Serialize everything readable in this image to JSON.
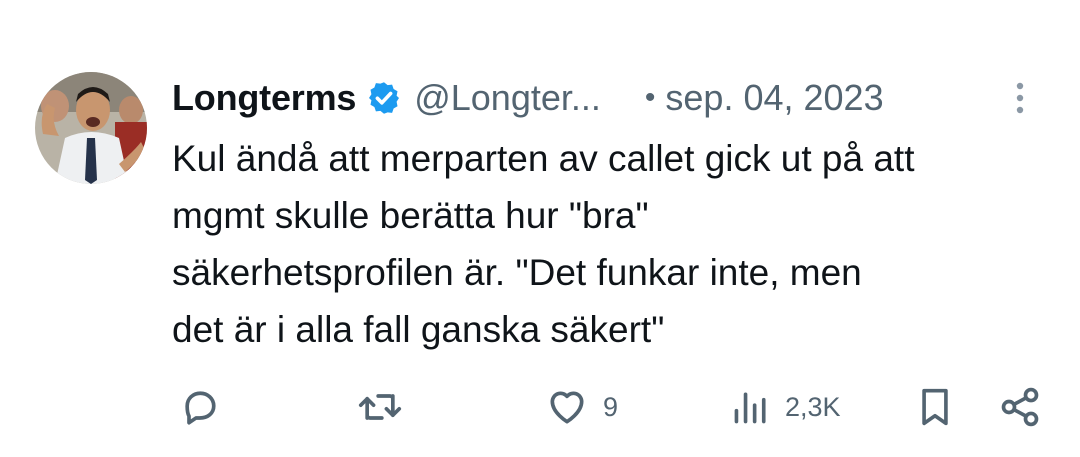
{
  "tweet": {
    "author_name": "Longterms",
    "handle": "@Longter...",
    "separator": "•",
    "date": "sep. 04, 2023",
    "text_lines": [
      "Kul ändå att merparten av callet gick ut på att",
      "mgmt skulle berätta hur \"bra\"",
      "säkerhetsprofilen är. \"Det funkar inte, men",
      "det är i alla fall ganska säkert\""
    ]
  },
  "actions": {
    "reply_icon": "reply-icon",
    "retweet_icon": "retweet-icon",
    "like_icon": "heart-icon",
    "like_count": "9",
    "views_icon": "views-icon",
    "views_count": "2,3K",
    "bookmark_icon": "bookmark-icon",
    "share_icon": "share-icon"
  },
  "colors": {
    "text": "#0f1419",
    "secondary": "#536471",
    "verified": "#1d9bf0"
  }
}
